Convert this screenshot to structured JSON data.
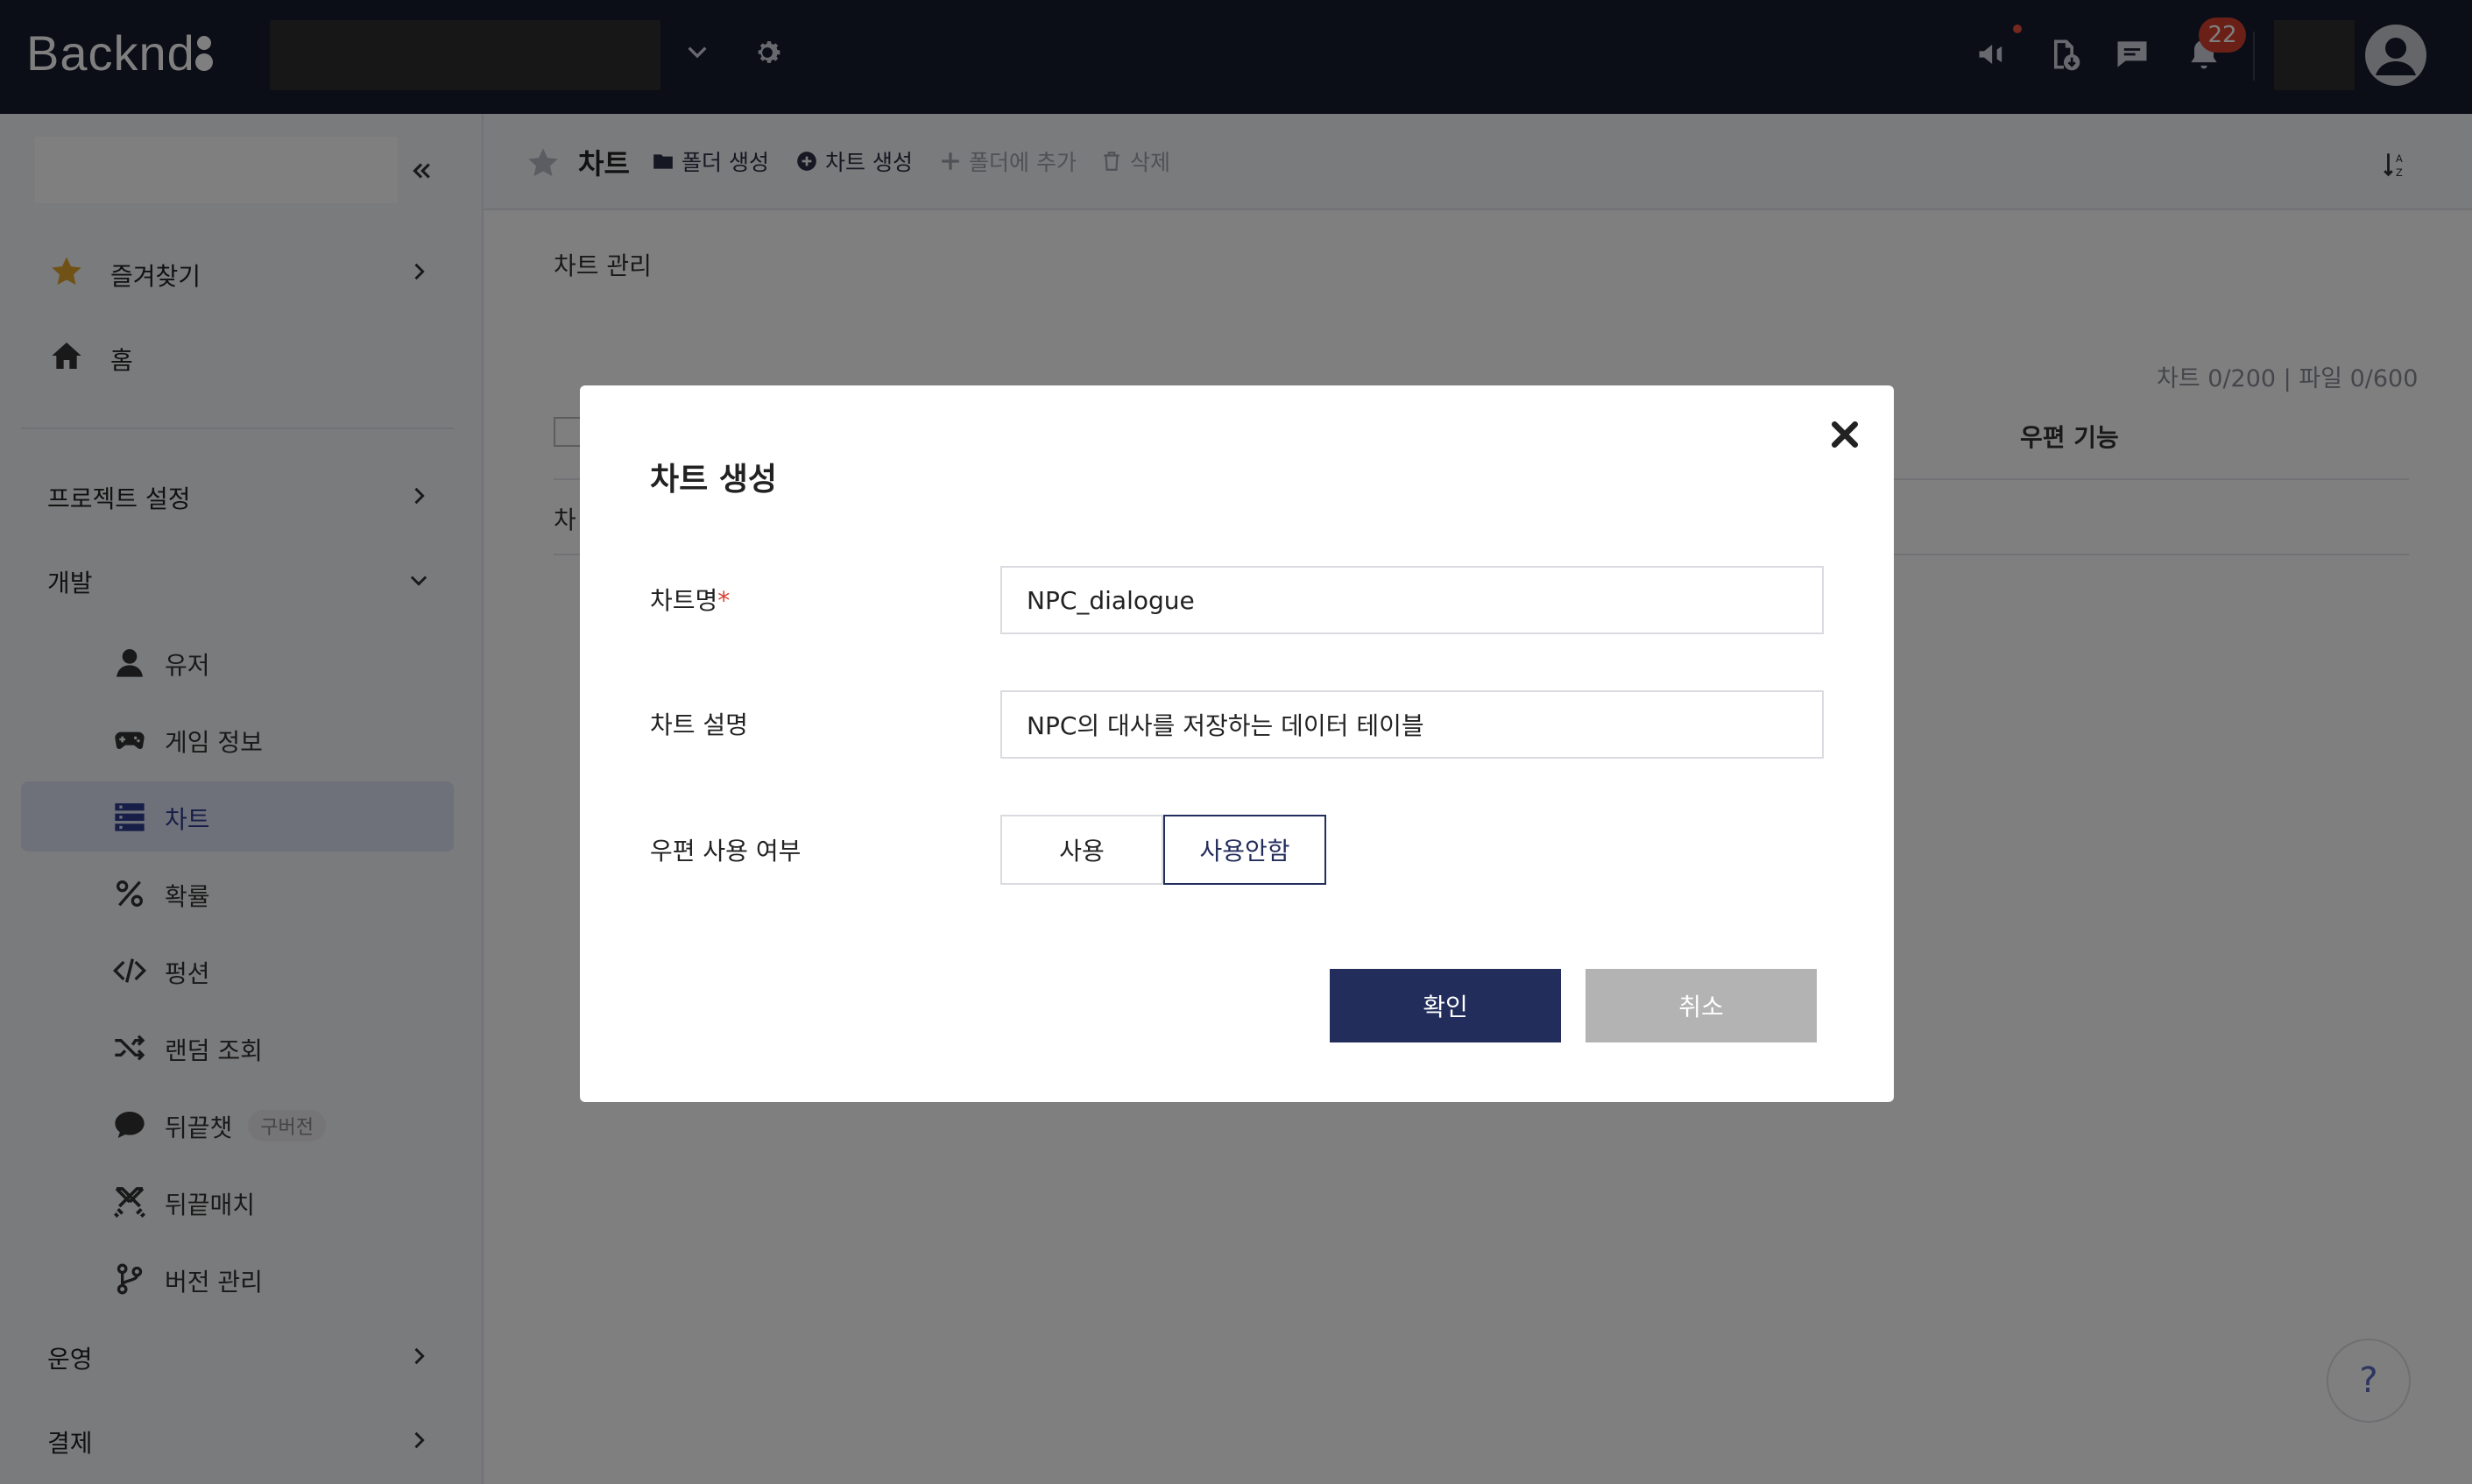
{
  "header": {
    "logo_text": "Backnd",
    "notification_count": "22"
  },
  "sidebar": {
    "favorites": "즐겨찾기",
    "home": "홈",
    "project_settings": "프로젝트 설정",
    "development": "개발",
    "items": [
      {
        "label": "유저"
      },
      {
        "label": "게임 정보"
      },
      {
        "label": "차트"
      },
      {
        "label": "확률"
      },
      {
        "label": "펑션"
      },
      {
        "label": "랜덤 조회"
      },
      {
        "label": "뒤끝챗",
        "tag": "구버전"
      },
      {
        "label": "뒤끝매치"
      },
      {
        "label": "버전 관리"
      }
    ],
    "operation": "운영",
    "billing": "결제"
  },
  "toolbar": {
    "title": "차트",
    "create_folder": "폴더 생성",
    "create_chart": "차트 생성",
    "add_to_folder": "폴더에 추가",
    "delete": "삭제"
  },
  "content": {
    "title": "차트 관리",
    "quota": "차트 0/200 | 파일 0/600",
    "mail_feature_col": "우편 기능",
    "row_text": "차"
  },
  "modal": {
    "title": "차트 생성",
    "chart_name_label": "차트명",
    "chart_name_required": "*",
    "chart_name_value": "NPC_dialogue",
    "chart_desc_label": "차트 설명",
    "chart_desc_value": "NPC의 대사를 저장하는 데이터 테이블",
    "mail_use_label": "우편 사용 여부",
    "mail_use_options": [
      "사용",
      "사용안함"
    ],
    "mail_use_selected": "사용안함",
    "confirm": "확인",
    "cancel": "취소"
  },
  "help": "?",
  "colors": {
    "topbar": "#161b2e",
    "primary": "#232d5c",
    "badge": "#d6402f",
    "active_nav": "#dde3f3"
  }
}
